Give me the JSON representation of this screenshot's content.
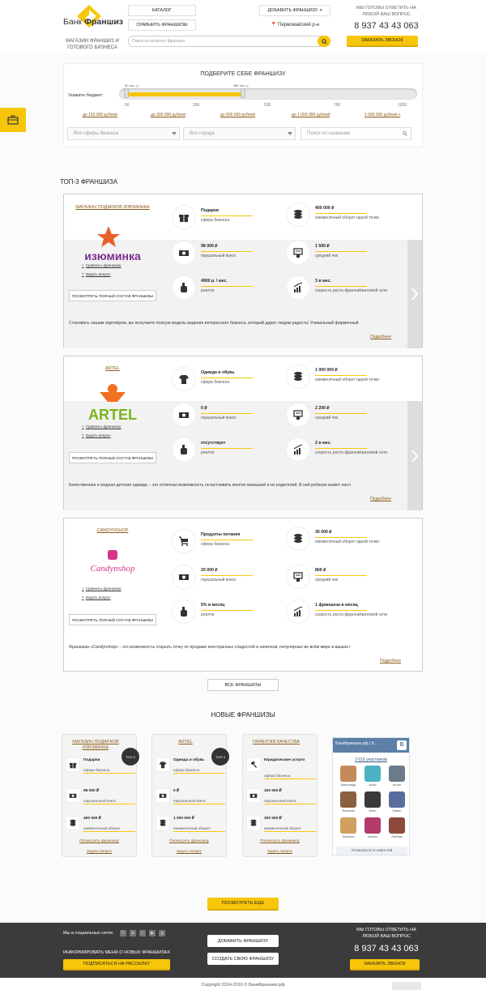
{
  "brand": {
    "name_light": "Банк ",
    "name_bold": "Франшиз",
    "tagline": "МАГАЗИН ФРАНШИЗ И ГОТОВОГО БИЗНЕСА",
    "accent": "#f7c60a"
  },
  "header": {
    "catalog_btn": "КАТАЛОГ",
    "compare_btn": "СРАВНИТЬ ФРАНШИЗЫ",
    "add_btn": "ДОБАВИТЬ ФРАНШИЗУ",
    "search_placeholder": "Поиск по каталогу франшиз",
    "city": "Первомайский р-н",
    "call_question": "МЫ ГОТОВЫ ОТВЕТИТЬ НА ЛЮБОЙ ВАШ ВОПРОС",
    "phone": "8 937 43 43 063",
    "order_call": "ЗАКАЗАТЬ ЗВОНОК"
  },
  "filter": {
    "title": "ПОДБЕРИТЕ СЕБЕ ФРАНШИЗУ",
    "budget_label": "Укажите бюджет:",
    "min_handle_label": "50 тыс. р.",
    "max_handle_label": "450 тыс. р.",
    "selected_min": 50,
    "selected_max": 450,
    "ticks": [
      "50",
      "290",
      "530",
      "760",
      "1000"
    ],
    "ranges": [
      "до 150 000 рублей",
      "до 300 000 рублей",
      "до 600 000 рублей",
      "до 1 000 000 рублей",
      "1 000 000 рублей +"
    ],
    "sphere_select": "Все сферы бизнеса",
    "city_select": "Все города",
    "name_placeholder": "Поиск по названию"
  },
  "top3": {
    "title": "ТОП-3 ФРАНШИЗА",
    "more_label": "Подробнее",
    "compare_label": "Сравнить франшизу",
    "ask_label": "Задать вопрос",
    "full_btn": "ПОСМОТРЕТЬ ПОЛНЫЙ СОСТАВ ФРАНШИЗЫ",
    "cards": [
      {
        "name": "МАГАЗИН ПОДАРКОВ ИЗЮМИНКА",
        "logo_text": "изюминка",
        "sphere": "Подарки",
        "sphere_lbl": "сфера бизнеса",
        "fee": "98 000 ₽",
        "fee_lbl": "паушальный взнос",
        "royalty": "4900 р. \\ мес.",
        "royalty_lbl": "роялти",
        "turnover": "400 000 ₽",
        "turnover_lbl": "ежемесячный оборот одной точки",
        "check": "1 500 ₽",
        "check_lbl": "средний чек",
        "growth": "3 в мес.",
        "growth_lbl": "скорость роста франчайзинговой сети",
        "desc": "Становясь нашим партнёром, вы получаете полную модель ведения интересного бизнеса, который дарит людям радость! Уникальный фирменный"
      },
      {
        "name": "ARTEL",
        "logo_text": "ARTEL",
        "sphere": "Одежда и обувь",
        "sphere_lbl": "сфера бизнеса",
        "fee": "0 ₽",
        "fee_lbl": "паушальный взнос",
        "royalty": "отсутствует",
        "royalty_lbl": "роялти",
        "turnover": "1 000 000 ₽",
        "turnover_lbl": "ежемесячный оборот одной точки",
        "check": "2 200 ₽",
        "check_lbl": "средний чек",
        "growth": "2 в мес.",
        "growth_lbl": "скорость роста франчайзинговой сети",
        "desc": "Качественная и модная детская одежда – это отличная возможность осчастливить многих малышей и их родителей. В ней ребенок может насл"
      },
      {
        "name": "CANDYNSHOP",
        "logo_text": "Candynshop",
        "sphere": "Продукты питания",
        "sphere_lbl": "сфера бизнеса",
        "fee": "20 000 ₽",
        "fee_lbl": "паушальный взнос",
        "royalty": "5% в месяц",
        "royalty_lbl": "роялти",
        "turnover": "30 000 ₽",
        "turnover_lbl": "ежемесячный оборот одной точки",
        "check": "800 ₽",
        "check_lbl": "средний чек",
        "growth": "1 франшиза в месяц",
        "growth_lbl": "скорость роста франчайзинговой сети",
        "desc": "Франшиза «Candynshop» - это возможность открыть точку по продаже иностранных сладостей и напитков, популярных во всём мире в вашем г"
      }
    ],
    "all_btn": "ВСЕ ФРАНШИЗЫ"
  },
  "newf": {
    "title": "НОВЫЕ ФРАНШИЗЫ",
    "badge": "ТОП 3",
    "compare_label": "Посмотреть франшизу",
    "ask_label": "Задать вопрос",
    "cards": [
      {
        "name": "МАГАЗИН ПОДАРКОВ ИЗЮМИНКА",
        "sphere": "Подарки",
        "sphere_lbl": "сфера бизнеса",
        "fee": "98 000 ₽",
        "fee_lbl": "паушальный взнос",
        "turnover": "400 000 ₽",
        "turnover_lbl": "ежемесячный оборот",
        "badge": true
      },
      {
        "name": "ARTEL",
        "sphere": "Одежда и обувь",
        "sphere_lbl": "сфера бизнеса",
        "fee": "0 ₽",
        "fee_lbl": "паушальный взнос",
        "turnover": "1 000 000 ₽",
        "turnover_lbl": "ежемесячный оборот",
        "badge": true
      },
      {
        "name": "ГАРАНТИЯ КАЧЕСТВА",
        "sphere": "Юридические услуги",
        "sphere_lbl": "сфера бизнеса",
        "fee": "150 000 ₽",
        "fee_lbl": "паушальный взнос",
        "turnover": "300 000 ₽",
        "turnover_lbl": "ежемесячный оборот",
        "badge": false
      }
    ],
    "more_btn": "ПОСМОТРЕТЬ ЕЩЕ"
  },
  "vk": {
    "title": "БанкФраншиз.рф | Б...",
    "count": "3 616 участников",
    "members": [
      "Александр",
      "Илья",
      "Антон",
      "Василий",
      "Иван",
      "Павел",
      "Наталья",
      "Ничего",
      "Любовь"
    ],
    "unsubscribe": "Отписаться от новостей"
  },
  "footer": {
    "social_label": "Мы в социальных сетях:",
    "subscribe_label": "ИНФОРМИРОВАТЬ МЕНЯ О НОВЫХ ФРАНШИЗАХ",
    "subscribe_btn": "ПОДПИСАТЬСЯ НА РАССЫЛКУ",
    "add_btn": "ДОБАВИТЬ ФРАНШИЗУ",
    "create_btn": "СОЗДАТЬ СВОЮ ФРАНШИЗУ",
    "call_question": "МЫ ГОТОВЫ ОТВЕТИТЬ НА ЛЮБОЙ ВАШ ВОПРОС",
    "phone": "8 937 43 43 063",
    "order_call": "ЗАКАЗАТЬ ЗВОНОК",
    "copyright": "Copyright 2014-2016 © БанкФраншиз.рф"
  }
}
